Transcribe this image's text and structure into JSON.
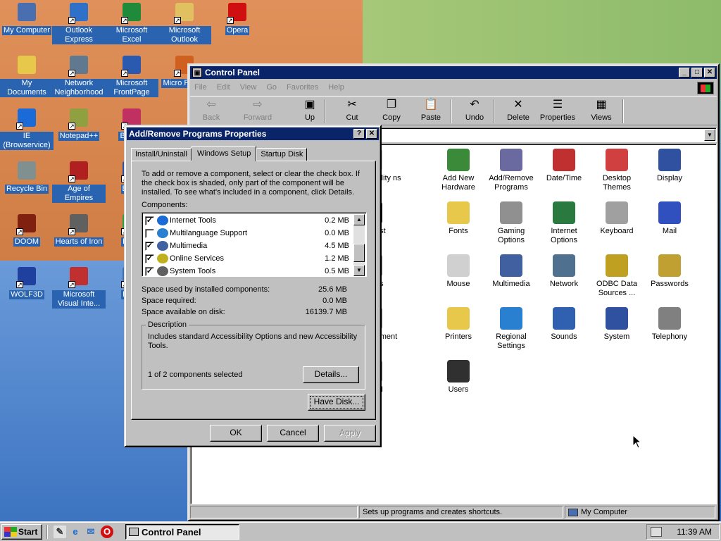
{
  "desktop": {
    "icons": [
      {
        "label": "My Computer",
        "icon": "my-computer-icon",
        "color": "#4a6fb0"
      },
      {
        "label": "Outlook Express",
        "icon": "outlook-express-icon",
        "color": "#2f70c8"
      },
      {
        "label": "Microsoft Excel",
        "icon": "excel-icon",
        "color": "#1f8a3a"
      },
      {
        "label": "Microsoft Outlook",
        "icon": "outlook-icon",
        "color": "#e0c060"
      },
      {
        "label": "Opera",
        "icon": "opera-icon",
        "color": "#d01010"
      },
      {
        "label": "My Documents",
        "icon": "folder-documents-icon",
        "color": "#e8c84a"
      },
      {
        "label": "Network Neighborhood",
        "icon": "network-icon",
        "color": "#607890"
      },
      {
        "label": "Microsoft FrontPage",
        "icon": "frontpage-icon",
        "color": "#2a5ab0"
      },
      {
        "label": "Micro Power",
        "icon": "powerpoint-icon",
        "color": "#d06020"
      },
      {
        "label": "IE (Browservice)",
        "icon": "ie-icon",
        "color": "#1a6ad8"
      },
      {
        "label": "Notepad++",
        "icon": "notepad-icon",
        "color": "#90a040"
      },
      {
        "label": "Belo D",
        "icon": "belo-icon",
        "color": "#c03060"
      },
      {
        "label": "Recycle Bin",
        "icon": "recycle-bin-icon",
        "color": "#809090"
      },
      {
        "label": "Age of Empires",
        "icon": "age-of-empires-icon",
        "color": "#b02020"
      },
      {
        "label": "Big D",
        "icon": "big-icon",
        "color": "#3050a0"
      },
      {
        "label": "DOOM",
        "icon": "doom-icon",
        "color": "#802010"
      },
      {
        "label": "Hearts of Iron",
        "icon": "hearts-of-iron-icon",
        "color": "#606060"
      },
      {
        "label": "Pegg",
        "icon": "pegg-icon",
        "color": "#30a040"
      },
      {
        "label": "WOLF3D",
        "icon": "wolf3d-icon",
        "color": "#2040a0"
      },
      {
        "label": "Microsoft Visual Inte...",
        "icon": "visual-interdev-icon",
        "color": "#c03030"
      },
      {
        "label": "Pl Zo",
        "icon": "pl-zo-icon",
        "color": "#4070b0"
      }
    ]
  },
  "control_panel": {
    "title": "Control Panel",
    "menu": [
      "File",
      "Edit",
      "View",
      "Go",
      "Favorites",
      "Help"
    ],
    "toolbar": [
      {
        "label": "Back",
        "icon": "back-arrow-icon",
        "glyph": "⇦",
        "enabled": false
      },
      {
        "label": "Forward",
        "icon": "forward-arrow-icon",
        "glyph": "⇨",
        "enabled": false
      },
      {
        "label": "Up",
        "icon": "up-folder-icon",
        "glyph": "▣",
        "enabled": true
      },
      {
        "label": "Cut",
        "icon": "scissors-icon",
        "glyph": "✂",
        "enabled": true
      },
      {
        "label": "Copy",
        "icon": "copy-icon",
        "glyph": "❐",
        "enabled": true
      },
      {
        "label": "Paste",
        "icon": "paste-icon",
        "glyph": "📋",
        "enabled": true
      },
      {
        "label": "Undo",
        "icon": "undo-icon",
        "glyph": "↶",
        "enabled": true
      },
      {
        "label": "Delete",
        "icon": "delete-x-icon",
        "glyph": "✕",
        "enabled": true
      },
      {
        "label": "Properties",
        "icon": "properties-icon",
        "glyph": "☰",
        "enabled": true
      },
      {
        "label": "Views",
        "icon": "views-icon",
        "glyph": "▦",
        "enabled": true
      }
    ],
    "items": [
      {
        "label": "bility ns",
        "icon": "accessibility-icon",
        "color": "#c0c0c0"
      },
      {
        "label": "Add New Hardware",
        "icon": "add-hardware-icon",
        "color": "#3a8a3a"
      },
      {
        "label": "Add/Remove Programs",
        "icon": "add-remove-programs-icon",
        "color": "#6a6aa0"
      },
      {
        "label": "Date/Time",
        "icon": "date-time-icon",
        "color": "#c03030"
      },
      {
        "label": "Desktop Themes",
        "icon": "desktop-themes-icon",
        "color": "#d04040"
      },
      {
        "label": "Display",
        "icon": "display-icon",
        "color": "#3050a0"
      },
      {
        "label": "nst",
        "icon": "fonts-partial-icon",
        "color": "#202020"
      },
      {
        "label": "Fonts",
        "icon": "fonts-folder-icon",
        "color": "#e8c84a"
      },
      {
        "label": "Gaming Options",
        "icon": "joystick-icon",
        "color": "#909090"
      },
      {
        "label": "Internet Options",
        "icon": "internet-options-icon",
        "color": "#2a7a40"
      },
      {
        "label": "Keyboard",
        "icon": "keyboard-icon",
        "color": "#a0a0a0"
      },
      {
        "label": "Mail",
        "icon": "mail-icon",
        "color": "#3050c0"
      },
      {
        "label": "ns",
        "icon": "partial-icon",
        "color": "#808080"
      },
      {
        "label": "Mouse",
        "icon": "mouse-icon",
        "color": "#d0d0d0"
      },
      {
        "label": "Multimedia",
        "icon": "multimedia-icon",
        "color": "#4060a0"
      },
      {
        "label": "Network",
        "icon": "network-icon",
        "color": "#507090"
      },
      {
        "label": "ODBC Data Sources ...",
        "icon": "odbc-icon",
        "color": "#c0a020"
      },
      {
        "label": "Passwords",
        "icon": "passwords-key-icon",
        "color": "#c0a030"
      },
      {
        "label": "r ment",
        "icon": "power-management-icon",
        "color": "#808080"
      },
      {
        "label": "Printers",
        "icon": "printers-folder-icon",
        "color": "#e8c84a"
      },
      {
        "label": "Regional Settings",
        "icon": "globe-icon",
        "color": "#2a80d0"
      },
      {
        "label": "Sounds",
        "icon": "sounds-icon",
        "color": "#3060b0"
      },
      {
        "label": "System",
        "icon": "system-icon",
        "color": "#3050a0"
      },
      {
        "label": "Telephony",
        "icon": "telephony-icon",
        "color": "#808080"
      },
      {
        "label": "UI",
        "icon": "tweakui-icon",
        "color": "#808080"
      },
      {
        "label": "Users",
        "icon": "users-icon",
        "color": "#303030"
      }
    ],
    "status_left": "Sets up programs and creates shortcuts.",
    "status_right": "My Computer"
  },
  "dialog": {
    "title": "Add/Remove Programs Properties",
    "tabs": [
      "Install/Uninstall",
      "Windows Setup",
      "Startup Disk"
    ],
    "active_tab": "Windows Setup",
    "instructions": "To add or remove a component, select or clear the check box. If the check box is shaded, only part of the component will be installed. To see what's included in a component, click Details.",
    "components_label": "Components:",
    "components": [
      {
        "name": "Internet Tools",
        "size": "0.2 MB",
        "checked": true,
        "icon": "ie-icon",
        "color": "#1a6ad8"
      },
      {
        "name": "Multilanguage Support",
        "size": "0.0 MB",
        "checked": false,
        "icon": "globe-icon",
        "color": "#2a80d0"
      },
      {
        "name": "Multimedia",
        "size": "4.5 MB",
        "checked": true,
        "icon": "multimedia-icon",
        "color": "#4060a0"
      },
      {
        "name": "Online Services",
        "size": "1.2 MB",
        "checked": true,
        "icon": "online-services-icon",
        "color": "#c0b020"
      },
      {
        "name": "System Tools",
        "size": "0.5 MB",
        "checked": true,
        "icon": "system-tools-icon",
        "color": "#606060"
      }
    ],
    "space_used_label": "Space used by installed components:",
    "space_used": "25.6 MB",
    "space_required_label": "Space required:",
    "space_required": "0.0 MB",
    "space_available_label": "Space available on disk:",
    "space_available": "16139.7 MB",
    "description_label": "Description",
    "description": "Includes standard Accessibility Options and new Accessibility Tools.",
    "selected_count": "1 of 2 components selected",
    "details_button": "Details...",
    "have_disk_button": "Have Disk...",
    "ok_button": "OK",
    "cancel_button": "Cancel",
    "apply_button": "Apply"
  },
  "taskbar": {
    "start_label": "Start",
    "task_button": "Control Panel",
    "clock": "11:39 AM"
  }
}
